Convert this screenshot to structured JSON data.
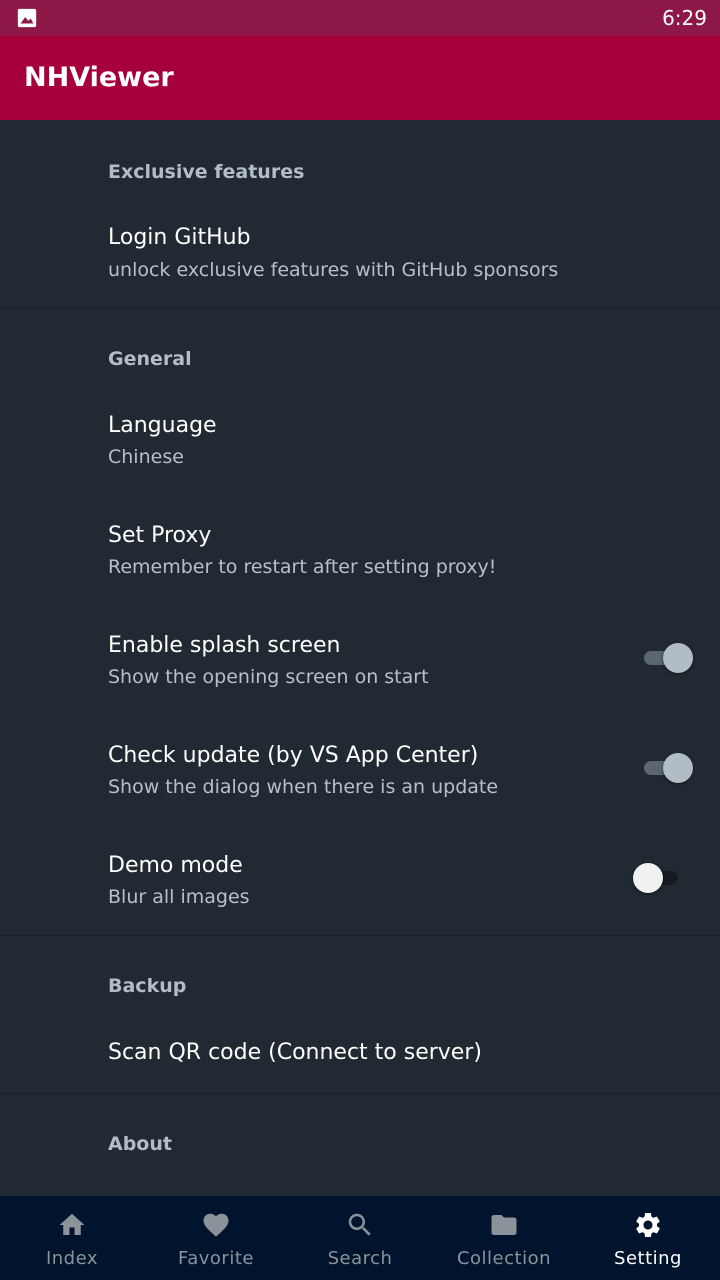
{
  "status_bar": {
    "time": "6:29",
    "notification_icon": "image-icon"
  },
  "app_bar": {
    "title": "NHViewer"
  },
  "sections": {
    "exclusive": {
      "header": "Exclusive features",
      "login": {
        "title": "Login GitHub",
        "summary": "unlock exclusive features with GitHub sponsors"
      }
    },
    "general": {
      "header": "General",
      "language": {
        "title": "Language",
        "summary": "Chinese"
      },
      "proxy": {
        "title": "Set Proxy",
        "summary": "Remember to restart after setting proxy!"
      },
      "splash": {
        "title": "Enable splash screen",
        "summary": "Show the opening screen on start",
        "enabled": true
      },
      "update": {
        "title": "Check update (by VS App Center)",
        "summary": "Show the dialog when there is an update",
        "enabled": true
      },
      "demo": {
        "title": "Demo mode",
        "summary": "Blur all images",
        "enabled": false
      }
    },
    "backup": {
      "header": "Backup",
      "scan": {
        "title": "Scan QR code (Connect to server)"
      }
    },
    "about": {
      "header": "About"
    }
  },
  "bottom_nav": {
    "items": [
      {
        "label": "Index",
        "icon": "home-icon",
        "active": false
      },
      {
        "label": "Favorite",
        "icon": "heart-icon",
        "active": false
      },
      {
        "label": "Search",
        "icon": "search-icon",
        "active": false
      },
      {
        "label": "Collection",
        "icon": "folder-icon",
        "active": false
      },
      {
        "label": "Setting",
        "icon": "gear-icon",
        "active": true
      }
    ]
  },
  "colors": {
    "status_bar": "#8d1848",
    "app_bar": "#a5003c",
    "background": "#212a33",
    "bottom_nav": "#01142e",
    "nav_active": "#ffffff",
    "nav_inactive": "#8c929a"
  }
}
